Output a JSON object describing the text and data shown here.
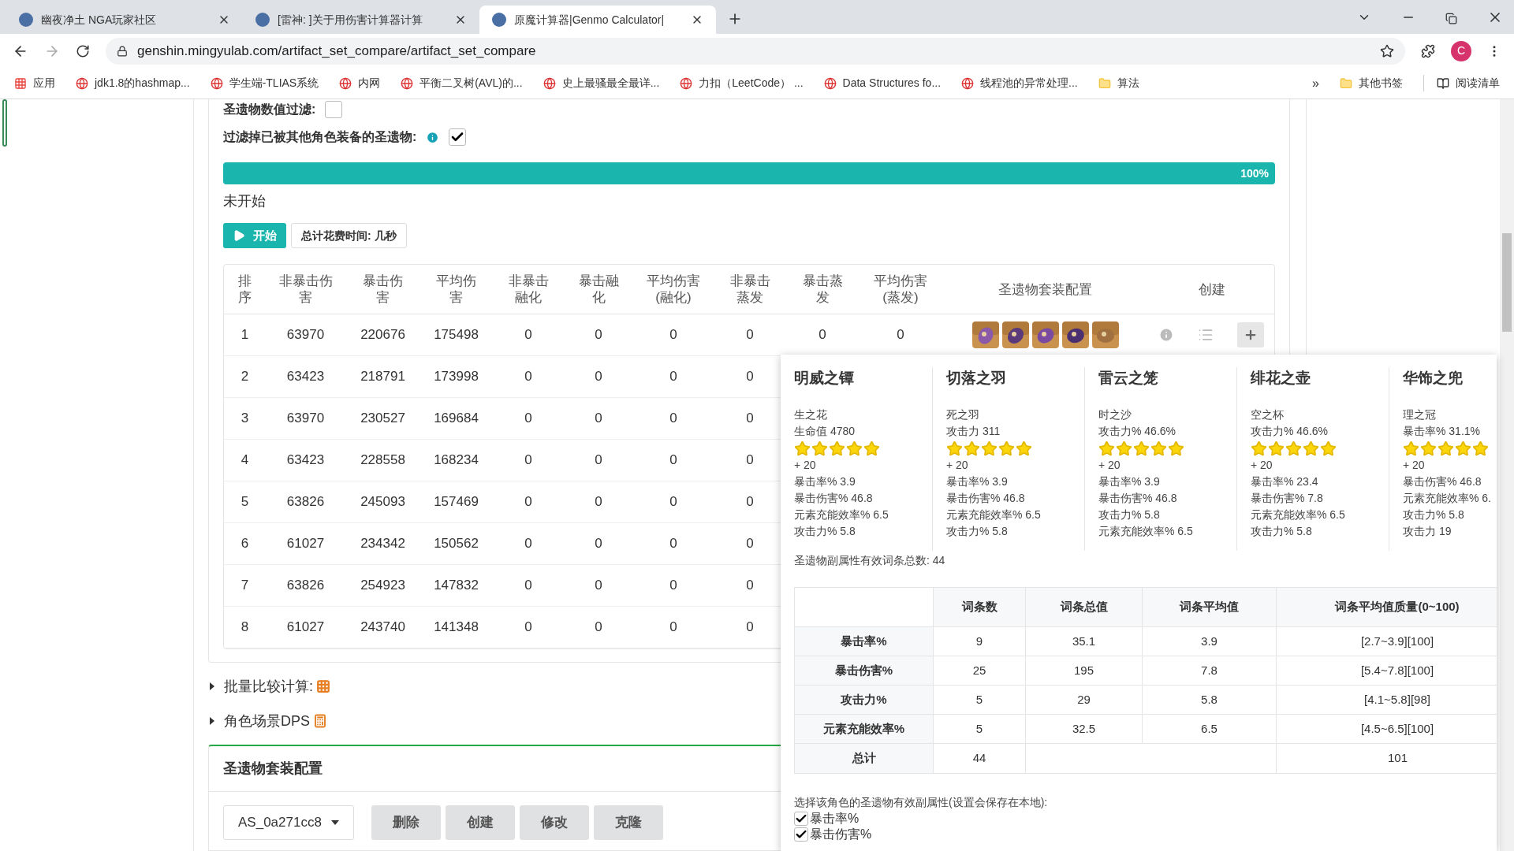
{
  "browser": {
    "tabs": [
      {
        "title": "幽夜净土 NGA玩家社区",
        "selected": false
      },
      {
        "title": "[雷神: ]关于用伤害计算器计算",
        "selected": false
      },
      {
        "title": "原魔计算器|Genmo Calculator|",
        "selected": true
      }
    ],
    "url": "genshin.mingyulab.com/artifact_set_compare/artifact_set_compare",
    "profile_initial": "C",
    "bookmarks": [
      {
        "label": "应用",
        "kind": "apps"
      },
      {
        "label": "jdk1.8的hashmap...",
        "kind": "site"
      },
      {
        "label": "学生端-TLIAS系统",
        "kind": "site"
      },
      {
        "label": "内网",
        "kind": "site"
      },
      {
        "label": "平衡二叉树(AVL)的...",
        "kind": "site"
      },
      {
        "label": "史上最骚最全最详...",
        "kind": "site"
      },
      {
        "label": "力扣（LeetCode） ...",
        "kind": "site"
      },
      {
        "label": "Data Structures fo...",
        "kind": "site"
      },
      {
        "label": "线程池的异常处理...",
        "kind": "site"
      },
      {
        "label": "算法",
        "kind": "folder"
      }
    ],
    "more": "»",
    "other_bookmarks": "其他书签",
    "reading_list": "阅读清单"
  },
  "filters": [
    {
      "label": "圣遗物数值过滤:",
      "checked": false,
      "info": false
    },
    {
      "label": "过滤掉已被其他角色装备的圣遗物:",
      "checked": true,
      "info": true
    }
  ],
  "progress": {
    "level": 1,
    "label": "100%"
  },
  "status": "未开始",
  "start_button": "开始",
  "time_button": "总计花费时间: 几秒",
  "table": {
    "columns": [
      "排序",
      "非暴击伤害",
      "暴击伤害",
      "平均伤害",
      "非暴击融化",
      "暴击融化",
      "平均伤害(融化)",
      "非暴击蒸发",
      "暴击蒸发",
      "平均伤害(蒸发)",
      "圣遗物套装配置",
      "创建"
    ],
    "rows": [
      {
        "cells": [
          "1",
          "63970",
          "220676",
          "175498",
          "0",
          "0",
          "0",
          "0",
          "0",
          "0"
        ],
        "actions_visible": true
      },
      {
        "cells": [
          "2",
          "63423",
          "218791",
          "173998",
          "0",
          "0",
          "0",
          "0"
        ]
      },
      {
        "cells": [
          "3",
          "63970",
          "230527",
          "169684",
          "0",
          "0",
          "0",
          "0"
        ]
      },
      {
        "cells": [
          "4",
          "63423",
          "228558",
          "168234",
          "0",
          "0",
          "0",
          "0"
        ]
      },
      {
        "cells": [
          "5",
          "63826",
          "245093",
          "157469",
          "0",
          "0",
          "0",
          "0"
        ]
      },
      {
        "cells": [
          "6",
          "61027",
          "234342",
          "150562",
          "0",
          "0",
          "0",
          "0"
        ]
      },
      {
        "cells": [
          "7",
          "63826",
          "254923",
          "147832",
          "0",
          "0",
          "0",
          "0"
        ]
      },
      {
        "cells": [
          "8",
          "61027",
          "243740",
          "141348",
          "0",
          "0",
          "0",
          "0"
        ]
      }
    ]
  },
  "sections": [
    {
      "label": "批量比较计算:",
      "kind": "grid",
      "expanded": false
    },
    {
      "label": "角色场景DPS",
      "kind": "calculator",
      "expanded": false
    }
  ],
  "config": {
    "title": "圣遗物套装配置",
    "dropdown": "AS_0a271cc8",
    "buttons": [
      "删除",
      "创建",
      "修改",
      "克隆"
    ]
  },
  "popup": {
    "artifacts": [
      {
        "name": "明威之镡",
        "slot": "生之花",
        "main_stat": "生命值 4780",
        "stars": 5,
        "enhance": "+ 20",
        "substats": [
          "暴击率% 3.9",
          "暴击伤害% 46.8",
          "元素充能效率% 6.5",
          "攻击力% 5.8"
        ]
      },
      {
        "name": "切落之羽",
        "slot": "死之羽",
        "main_stat": "攻击力 311",
        "stars": 5,
        "enhance": "+ 20",
        "substats": [
          "暴击率% 3.9",
          "暴击伤害% 46.8",
          "元素充能效率% 6.5",
          "攻击力% 5.8"
        ]
      },
      {
        "name": "雷云之笼",
        "slot": "时之沙",
        "main_stat": "攻击力% 46.6%",
        "stars": 5,
        "enhance": "+ 20",
        "substats": [
          "暴击率% 3.9",
          "暴击伤害% 46.8",
          "攻击力% 5.8",
          "元素充能效率% 6.5"
        ]
      },
      {
        "name": "绯花之壶",
        "slot": "空之杯",
        "main_stat": "攻击力% 46.6%",
        "stars": 5,
        "enhance": "+ 20",
        "substats": [
          "暴击率% 23.4",
          "暴击伤害% 7.8",
          "元素充能效率% 6.5",
          "攻击力% 5.8"
        ]
      },
      {
        "name": "华饰之兜",
        "slot": "理之冠",
        "main_stat": "暴击率% 31.1%",
        "stars": 5,
        "enhance": "+ 20",
        "substats": [
          "暴击伤害% 46.8",
          "元素充能效率% 6.",
          "攻击力% 5.8",
          "攻击力 19"
        ]
      }
    ],
    "summary": "圣遗物副属性有效词条总数: 44",
    "stats": {
      "columns": [
        "词条数",
        "词条总值",
        "词条平均值",
        "词条平均值质量(0~100)"
      ],
      "rows": [
        {
          "label": "暴击率%",
          "cells": [
            "9",
            "35.1",
            "3.9",
            "[2.7~3.9][100]"
          ]
        },
        {
          "label": "暴击伤害%",
          "cells": [
            "25",
            "195",
            "7.8",
            "[5.4~7.8][100]"
          ]
        },
        {
          "label": "攻击力%",
          "cells": [
            "5",
            "29",
            "5.8",
            "[4.1~5.8][98]"
          ]
        },
        {
          "label": "元素充能效率%",
          "cells": [
            "5",
            "32.5",
            "6.5",
            "[4.5~6.5][100]"
          ]
        }
      ],
      "total": {
        "label": "总计",
        "count": "44",
        "quality": "101"
      }
    },
    "prompt": "选择该角色的圣遗物有效副属性(设置会保存在本地):",
    "options": [
      {
        "label": "暴击率%",
        "checked": true
      },
      {
        "label": "暴击伤害%",
        "checked": true
      }
    ]
  }
}
